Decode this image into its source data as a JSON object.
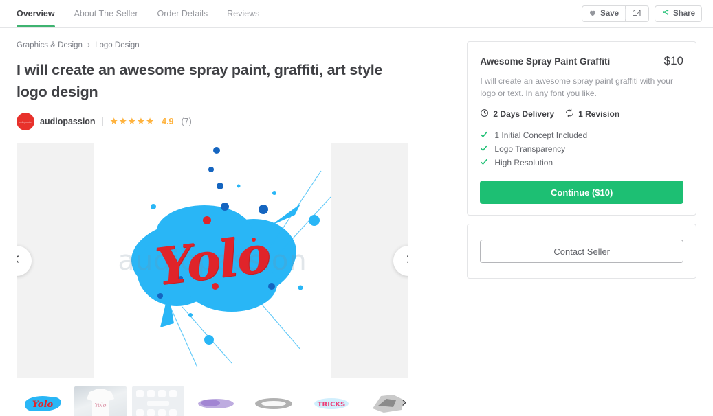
{
  "nav": {
    "tabs": [
      {
        "label": "Overview",
        "active": true
      },
      {
        "label": "About The Seller",
        "active": false
      },
      {
        "label": "Order Details",
        "active": false
      },
      {
        "label": "Reviews",
        "active": false
      }
    ],
    "save_label": "Save",
    "save_count": "14",
    "share_label": "Share"
  },
  "breadcrumb": {
    "category": "Graphics & Design",
    "separator": "›",
    "subcategory": "Logo Design"
  },
  "gig": {
    "title": "I will create an awesome spray paint, graffiti, art style logo design",
    "seller": "audiopassion",
    "avatar_text": "audiopassion",
    "rating": "4.9",
    "rating_count": "(7)",
    "stars": 5
  },
  "gallery": {
    "prev_label": "Previous image",
    "next_label": "Next image",
    "main_art_text": "Yolo",
    "watermark": "audiopassion",
    "thumbnails": [
      {
        "name": "thumb-yolo-splatter",
        "type": "art"
      },
      {
        "name": "thumb-tshirt-mockup",
        "type": "shirt"
      },
      {
        "name": "thumb-icon-grid",
        "type": "grid"
      },
      {
        "name": "thumb-purple-graffiti",
        "type": "art"
      },
      {
        "name": "thumb-gray-graffiti",
        "type": "art"
      },
      {
        "name": "thumb-pink-tricks",
        "type": "art"
      },
      {
        "name": "thumb-sketch-graffiti",
        "type": "art"
      }
    ],
    "thumbs_next_label": "More thumbnails"
  },
  "package": {
    "title": "Awesome Spray Paint Graffiti",
    "price": "$10",
    "description": "I will create an awesome spray paint graffiti with your logo or text. In any font you like.",
    "delivery": "2 Days Delivery",
    "revisions": "1 Revision",
    "features": [
      "1 Initial Concept Included",
      "Logo Transparency",
      "High Resolution"
    ],
    "continue_label": "Continue ($10)"
  },
  "contact": {
    "button_label": "Contact Seller"
  },
  "colors": {
    "accent_green": "#1dbf73",
    "tab_underline": "#3eb370",
    "star_gold": "#ffb33e",
    "avatar_red": "#e8312b",
    "art_cyan": "#29b6f6",
    "art_red": "#e0242a"
  }
}
